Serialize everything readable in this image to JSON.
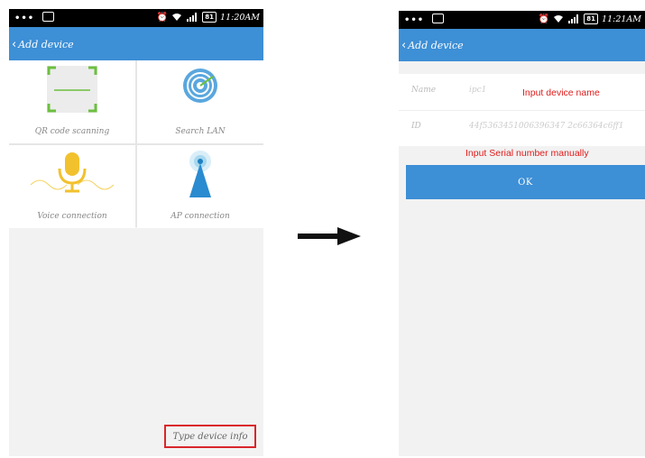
{
  "left_screen": {
    "status": {
      "dots": "•••",
      "time": "11:20AM",
      "battery": "81"
    },
    "title": "Add device",
    "back_icon": "‹",
    "tiles": [
      {
        "label": "QR code scanning",
        "icon": "qr-scan-icon"
      },
      {
        "label": "Search LAN",
        "icon": "radar-icon"
      },
      {
        "label": "Voice connection",
        "icon": "microphone-icon"
      },
      {
        "label": "AP connection",
        "icon": "ap-tower-icon"
      }
    ],
    "type_info_label": "Type device info"
  },
  "right_screen": {
    "status": {
      "dots": "•••",
      "time": "11:21AM",
      "battery": "81"
    },
    "title": "Add device",
    "back_icon": "‹",
    "fields": [
      {
        "label": "Name",
        "value": "ipc1"
      },
      {
        "label": "ID",
        "value": "44f5363451006396347 2c66364c6ff1"
      }
    ],
    "ok_label": "OK"
  },
  "annotations": {
    "name_note": "Input device name",
    "serial_note": "Input Serial number manually"
  },
  "colors": {
    "accent": "#3d8fd6",
    "highlight": "#d9262b",
    "note": "#e01b1b"
  }
}
